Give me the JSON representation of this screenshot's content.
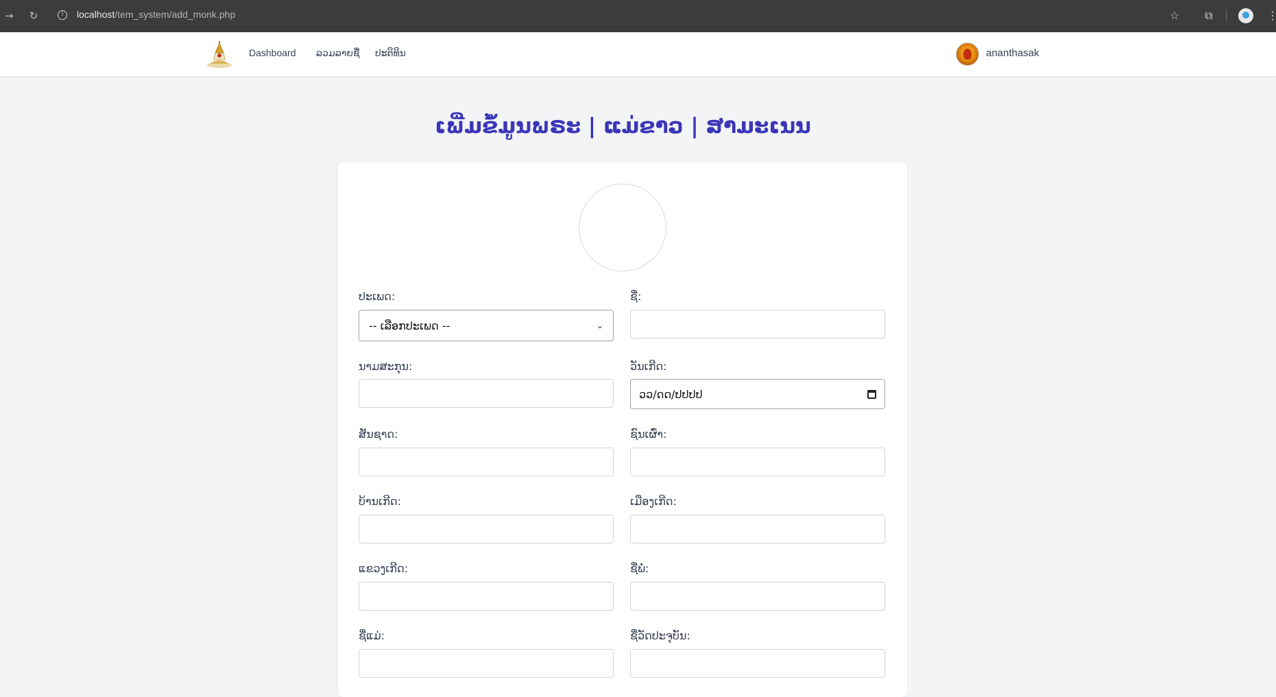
{
  "browser": {
    "url_host": "localhost",
    "url_path": "/tem_system/add_monk.php"
  },
  "nav": {
    "links": [
      "Dashboard",
      "ລວມລາຍຊື່",
      "ປະຕິທິນ"
    ],
    "username": "ananthasak"
  },
  "page": {
    "title": "ເພີ່ມຂໍ້ມູນພຣະ | ແມ່ຂາວ | ສາມະເນນ"
  },
  "form": {
    "type_label": "ປະເພດ:",
    "type_selected": "-- ເລືອກປະເພດ --",
    "name_label": "ຊື່:",
    "surname_label": "ນາມສະກຸນ:",
    "birthdate_label": "ວັນເກີດ:",
    "birthdate_placeholder": "ວວ/ດດ/ປປປປ",
    "nationality_label": "ສັນຊາດ:",
    "ethnicity_label": "ຊົນເຜົ່າ:",
    "birth_village_label": "ບ້ານເກີດ:",
    "birth_district_label": "ເມືອງເກີດ:",
    "birth_province_label": "ແຂວງເກີດ:",
    "father_name_label": "ຊື່ພໍ່:",
    "mother_name_label": "ຊື່ແມ່:",
    "current_temple_label": "ຊື່ວັດປະຈຸບັນ:"
  }
}
